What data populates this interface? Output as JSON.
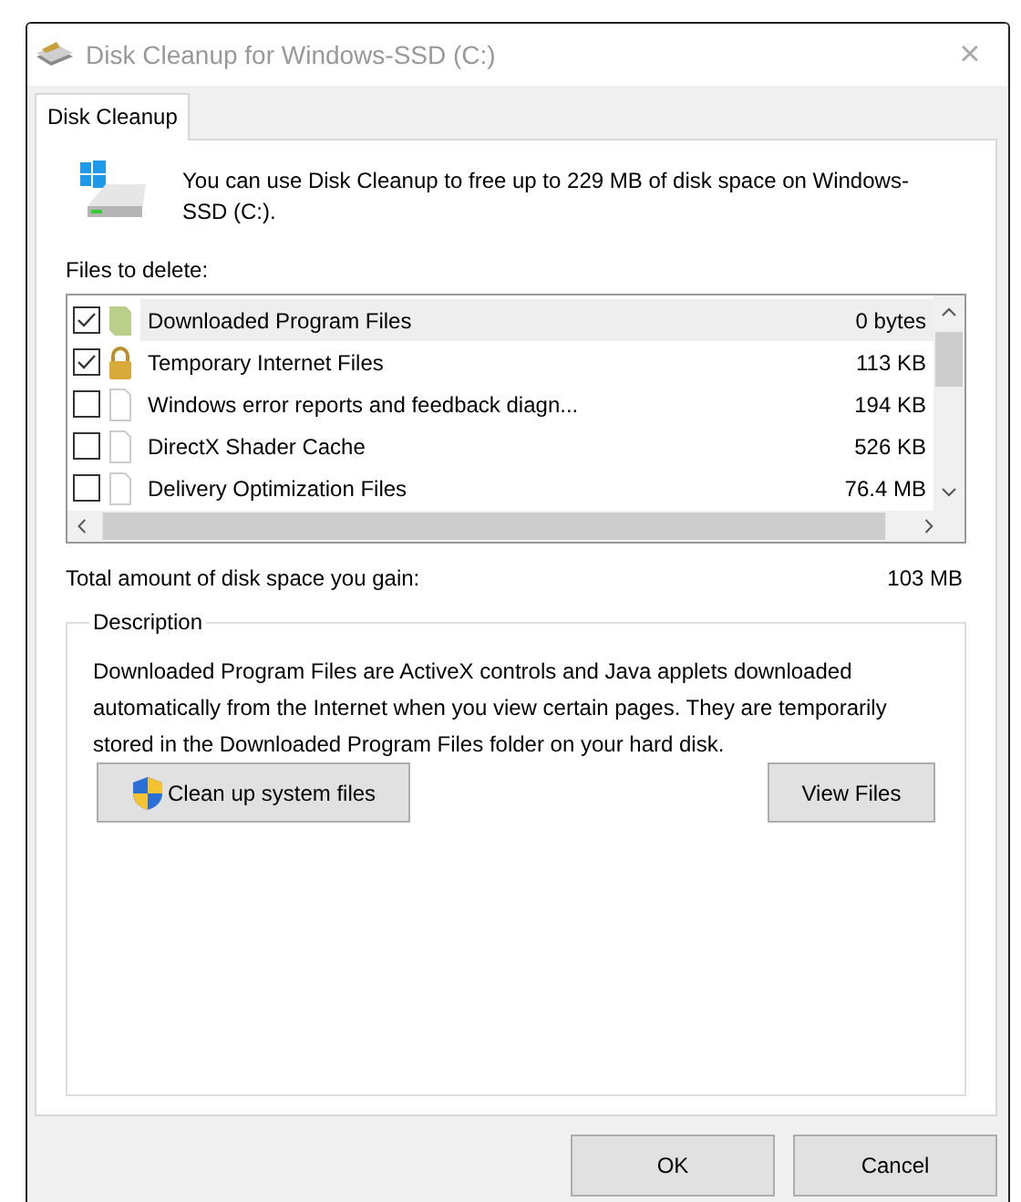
{
  "window": {
    "title": "Disk Cleanup for Windows-SSD (C:)",
    "close": "×"
  },
  "tabs": [
    {
      "label": "Disk Cleanup",
      "selected": true
    }
  ],
  "intro": "You can use Disk Cleanup to free up to 229 MB of disk space on Windows-SSD (C:).",
  "files_label": "Files to delete:",
  "files": [
    {
      "kind": "folder",
      "name": "Downloaded Program Files",
      "size": "0 bytes",
      "checked": true,
      "selected": true
    },
    {
      "kind": "lock",
      "name": "Temporary Internet Files",
      "size": "113 KB",
      "checked": true,
      "selected": false
    },
    {
      "kind": "document",
      "name": "Windows error reports and feedback diagn...",
      "size": "194 KB",
      "checked": false,
      "selected": false
    },
    {
      "kind": "document",
      "name": "DirectX Shader Cache",
      "size": "526 KB",
      "checked": false,
      "selected": false
    },
    {
      "kind": "document",
      "name": "Delivery Optimization Files",
      "size": "76.4 MB",
      "checked": false,
      "selected": false
    }
  ],
  "total": {
    "label": "Total amount of disk space you gain:",
    "value": "103 MB"
  },
  "description": {
    "title": "Description",
    "text": "Downloaded Program Files are ActiveX controls and Java applets downloaded automatically from the Internet when you view certain pages. They are temporarily stored in the Downloaded Program Files folder on your hard disk."
  },
  "panel_buttons": [
    {
      "label": "Clean up system files",
      "kind": "admin"
    },
    {
      "label": "View Files",
      "kind": "plain"
    }
  ],
  "buttons": [
    "OK",
    "Cancel"
  ]
}
